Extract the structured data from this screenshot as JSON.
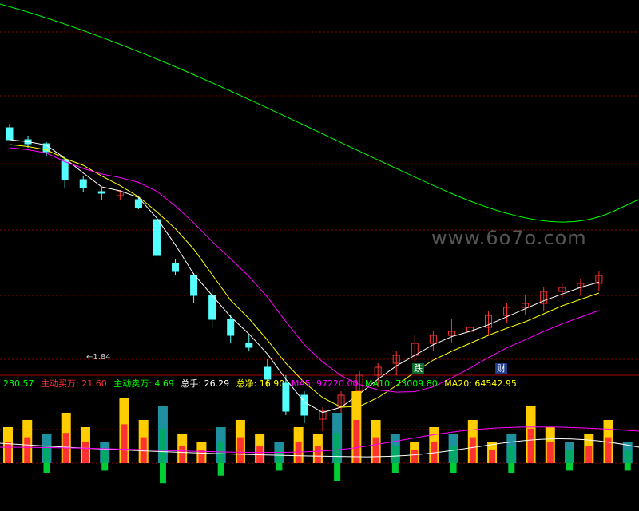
{
  "colors": {
    "bg": "#000000",
    "grid": "#8b0000",
    "up": "#ff3232",
    "down": "#54ffff",
    "ma5": "#ffffff",
    "ma10": "#ffff00",
    "ma20": "#ff00ff",
    "ma60": "#00ff00"
  },
  "tags": {
    "fall": "跌",
    "finance": "财"
  },
  "low_label": "←1.84",
  "watermark": "www.6o7o.com",
  "indicator_bar": [
    {
      "text": "230.57",
      "color": "#00ff00"
    },
    {
      "text": "主动买万: 21.60",
      "color": "#ff3232"
    },
    {
      "text": "主动卖万: 4.69",
      "color": "#00ff00"
    },
    {
      "text": "总手: 26.29",
      "color": "#ffffff"
    },
    {
      "text": "总净: 16.90",
      "color": "#ffff00"
    },
    {
      "text": "MA5: 97220.00",
      "color": "#ff00ff"
    },
    {
      "text": "MA10: 73009.80",
      "color": "#00ff00"
    },
    {
      "text": "MA20: 64542.95",
      "color": "#ffff00"
    }
  ],
  "chart_data": {
    "type": "candlestick",
    "candles": [
      [
        110,
        115,
        105,
        95
      ],
      [
        95,
        100,
        85,
        90
      ],
      [
        90,
        92,
        75,
        80
      ],
      [
        70,
        75,
        35,
        45
      ],
      [
        45,
        50,
        30,
        35
      ],
      [
        30,
        35,
        20,
        28
      ],
      [
        25,
        32,
        20,
        30
      ],
      [
        20,
        22,
        8,
        10
      ],
      [
        -5,
        0,
        -60,
        -50
      ],
      [
        -60,
        -55,
        -75,
        -70
      ],
      [
        -75,
        -72,
        -110,
        -100
      ],
      [
        -100,
        -90,
        -140,
        -130
      ],
      [
        -130,
        -125,
        -160,
        -150
      ],
      [
        -160,
        -150,
        -170,
        -165
      ],
      [
        -190,
        -180,
        -215,
        -205
      ],
      [
        -210,
        -200,
        -250,
        -245
      ],
      [
        -225,
        -220,
        -260,
        -250
      ],
      [
        -255,
        -240,
        -270,
        -245
      ],
      [
        -240,
        -220,
        -255,
        -225
      ],
      [
        -220,
        -195,
        -230,
        -200
      ],
      [
        -200,
        -185,
        -215,
        -190
      ],
      [
        -185,
        -170,
        -200,
        -175
      ],
      [
        -175,
        -150,
        -185,
        -160
      ],
      [
        -160,
        -145,
        -170,
        -150
      ],
      [
        -150,
        -130,
        -160,
        -145
      ],
      [
        -145,
        -135,
        -160,
        -140
      ],
      [
        -140,
        -120,
        -150,
        -125
      ],
      [
        -125,
        -110,
        -135,
        -115
      ],
      [
        -115,
        -100,
        -125,
        -110
      ],
      [
        -110,
        -90,
        -120,
        -95
      ],
      [
        -95,
        -85,
        -105,
        -90
      ],
      [
        -90,
        -80,
        -100,
        -85
      ],
      [
        -85,
        -70,
        -95,
        -75
      ]
    ],
    "ma20_ratio": "low-to-high",
    "volume": [
      [
        0.5,
        "up"
      ],
      [
        0.6,
        "up"
      ],
      [
        0.4,
        "down"
      ],
      [
        0.7,
        "up"
      ],
      [
        0.5,
        "up"
      ],
      [
        0.3,
        "down"
      ],
      [
        0.9,
        "up"
      ],
      [
        0.6,
        "up"
      ],
      [
        0.8,
        "down"
      ],
      [
        0.4,
        "up"
      ],
      [
        0.3,
        "up"
      ],
      [
        0.5,
        "down"
      ],
      [
        0.6,
        "up"
      ],
      [
        0.4,
        "up"
      ],
      [
        0.3,
        "down"
      ],
      [
        0.5,
        "up"
      ],
      [
        0.4,
        "up"
      ],
      [
        0.7,
        "down"
      ],
      [
        1.0,
        "up"
      ],
      [
        0.6,
        "up"
      ],
      [
        0.4,
        "down"
      ],
      [
        0.3,
        "up"
      ],
      [
        0.5,
        "up"
      ],
      [
        0.4,
        "down"
      ],
      [
        0.6,
        "up"
      ],
      [
        0.3,
        "up"
      ],
      [
        0.4,
        "down"
      ],
      [
        0.8,
        "up"
      ],
      [
        0.5,
        "up"
      ],
      [
        0.3,
        "down"
      ],
      [
        0.4,
        "up"
      ],
      [
        0.6,
        "up"
      ],
      [
        0.3,
        "down"
      ]
    ]
  }
}
